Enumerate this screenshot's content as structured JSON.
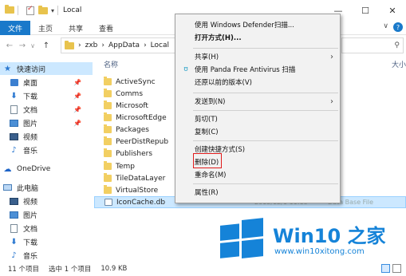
{
  "window": {
    "title": "Local",
    "controls": [
      "—",
      "☐",
      "✕"
    ]
  },
  "ribbon": {
    "tabs": [
      "文件",
      "主页",
      "共享",
      "查看"
    ],
    "expand": "∨",
    "help": "?"
  },
  "addressbar": {
    "back": "←",
    "forward": "→",
    "recent": "∨",
    "up": "↑",
    "crumbs": [
      "›",
      "zxb",
      "›",
      "AppData",
      "›",
      "Local"
    ],
    "search_icon": "search-icon"
  },
  "navpane": {
    "items": [
      {
        "label": "快速访问",
        "icon": "star-icon",
        "pinned": false
      },
      {
        "label": "桌面",
        "icon": "desktop-icon",
        "pinned": true
      },
      {
        "label": "下载",
        "icon": "download-icon",
        "pinned": true
      },
      {
        "label": "文档",
        "icon": "document-icon",
        "pinned": true
      },
      {
        "label": "图片",
        "icon": "picture-icon",
        "pinned": true
      },
      {
        "label": "视频",
        "icon": "video-icon",
        "pinned": false
      },
      {
        "label": "音乐",
        "icon": "music-icon",
        "pinned": false
      },
      {
        "label": "OneDrive",
        "icon": "cloud-icon",
        "pinned": false
      },
      {
        "label": "此电脑",
        "icon": "computer-icon",
        "pinned": false
      },
      {
        "label": "视频",
        "icon": "video-icon",
        "pinned": false
      },
      {
        "label": "图片",
        "icon": "picture-icon",
        "pinned": false
      },
      {
        "label": "文档",
        "icon": "document-icon",
        "pinned": false
      },
      {
        "label": "下载",
        "icon": "download-icon",
        "pinned": false
      },
      {
        "label": "音乐",
        "icon": "music-icon",
        "pinned": false
      }
    ]
  },
  "filelist": {
    "col_name": "名称",
    "col_size": "大小",
    "files": [
      {
        "name": "ActiveSync",
        "type": "folder"
      },
      {
        "name": "Comms",
        "type": "folder"
      },
      {
        "name": "Microsoft",
        "type": "folder"
      },
      {
        "name": "MicrosoftEdge",
        "type": "folder"
      },
      {
        "name": "Packages",
        "type": "folder"
      },
      {
        "name": "PeerDistRepub",
        "type": "folder"
      },
      {
        "name": "Publishers",
        "type": "folder"
      },
      {
        "name": "Temp",
        "type": "folder"
      },
      {
        "name": "TileDataLayer",
        "type": "folder"
      },
      {
        "name": "VirtualStore",
        "type": "folder"
      },
      {
        "name": "IconCache.db",
        "type": "file",
        "date": "2015/12/1 11:18",
        "filetype": "Data Base File",
        "selected": true
      }
    ]
  },
  "status": {
    "count": "11 个项目",
    "selected": "选中 1 个项目",
    "size": "10.9 KB"
  },
  "context_menu": {
    "items": [
      {
        "label": "使用 Windows Defender扫描...",
        "bold": false,
        "arrow": false
      },
      {
        "label": "打开方式(H)...",
        "bold": true,
        "arrow": false
      },
      {
        "label": "共享(H)",
        "bold": false,
        "arrow": true
      },
      {
        "label": "使用 Panda Free Antivirus 扫描",
        "bold": false,
        "arrow": false,
        "icon": "panda-icon"
      },
      {
        "label": "还原以前的版本(V)",
        "bold": false,
        "arrow": false
      },
      {
        "label": "发送到(N)",
        "bold": false,
        "arrow": true
      },
      {
        "label": "剪切(T)",
        "bold": false,
        "arrow": false
      },
      {
        "label": "复制(C)",
        "bold": false,
        "arrow": false
      },
      {
        "label": "创建快捷方式(S)",
        "bold": false,
        "arrow": false
      },
      {
        "label": "删除(D)",
        "bold": false,
        "arrow": false,
        "highlight": true
      },
      {
        "label": "重命名(M)",
        "bold": false,
        "arrow": false
      },
      {
        "label": "属性(R)",
        "bold": false,
        "arrow": false
      }
    ],
    "highlight_color": "#e01b1b"
  },
  "watermark": {
    "brand": "Win10 之家",
    "url": "www.win10xitong.com",
    "color": "#1583d8"
  }
}
